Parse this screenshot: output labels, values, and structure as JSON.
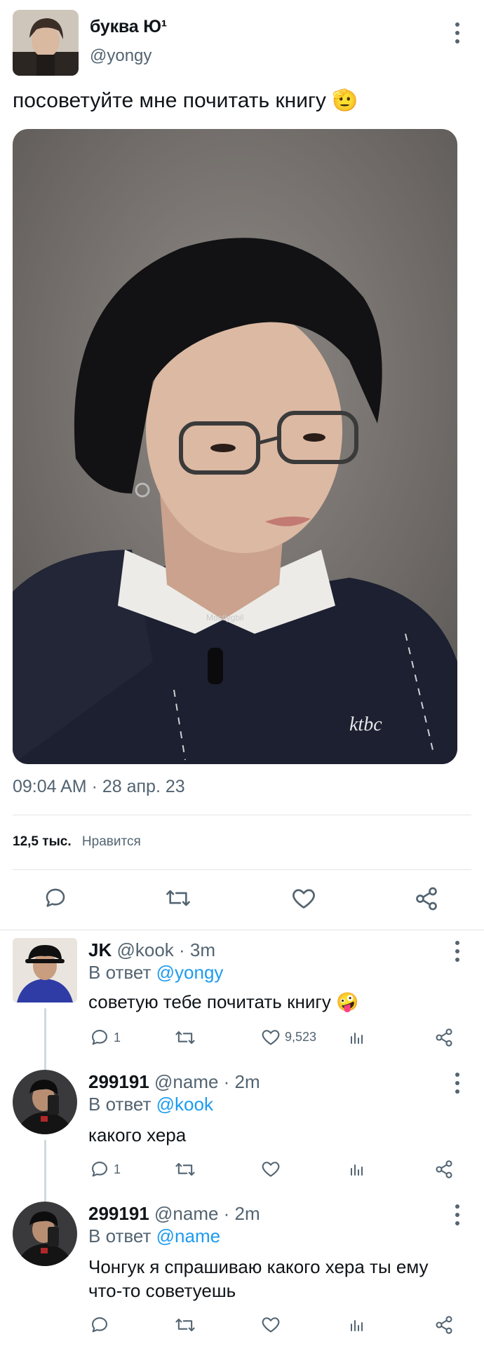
{
  "tweet": {
    "display_name": "буква Ю¹",
    "handle": "@yongy",
    "text": "посоветуйте мне почитать книгу",
    "text_emoji": "🫡",
    "meta": "09:04 AM · 28 апр. 23",
    "likes_count": "12,5 тыс.",
    "likes_label": "Нравится",
    "image_watermark": "Mostlygbil",
    "shirt_logo": "ktbc"
  },
  "replies": [
    {
      "name": "JK",
      "handle": "@kook",
      "time": "· 3m",
      "reply_prefix": "В ответ",
      "reply_to": "@yongy",
      "text": "советую тебе почитать книгу",
      "text_emoji": "🤪",
      "reply_count": "1",
      "like_count": "9,523"
    },
    {
      "name": "299191",
      "handle": "@name",
      "time": "· 2m",
      "reply_prefix": "В ответ",
      "reply_to": "@kook",
      "text": "какого хера",
      "reply_count": "1"
    },
    {
      "name": "299191",
      "handle": "@name",
      "time": "· 2m",
      "reply_prefix": "В ответ",
      "reply_to": "@name",
      "text_line1": "Чонгук я спрашиваю какого хера ты ему",
      "text_line2": "что-то советуешь"
    }
  ],
  "icons": {
    "reply": "reply-icon",
    "retweet": "retweet-icon",
    "like": "heart-icon",
    "share": "share-icon",
    "views": "analytics-icon",
    "more": "more-vertical-icon"
  },
  "colors": {
    "link": "#1d9bf0",
    "muted": "#536471",
    "divider": "#e1e5e8"
  }
}
